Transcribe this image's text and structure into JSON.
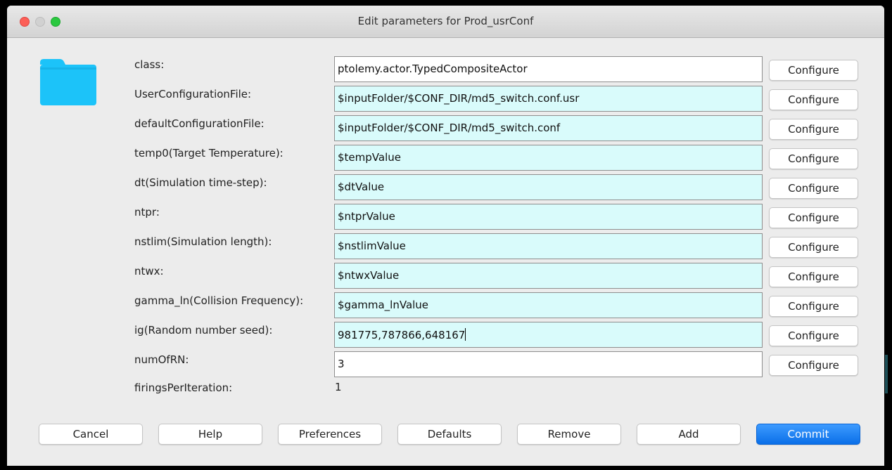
{
  "window": {
    "title": "Edit parameters for Prod_usrConf"
  },
  "icons": {
    "folder": "folder-icon",
    "folder_color": "#1cc3f9"
  },
  "params": [
    {
      "label": "class:",
      "value": "ptolemy.actor.TypedCompositeActor",
      "configure": "Configure"
    },
    {
      "label": "UserConfigurationFile:",
      "value": "$inputFolder/$CONF_DIR/md5_switch.conf.usr",
      "configure": "Configure"
    },
    {
      "label": "defaultConfigurationFile:",
      "value": "$inputFolder/$CONF_DIR/md5_switch.conf",
      "configure": "Configure"
    },
    {
      "label": "temp0(Target Temperature):",
      "value": "$tempValue",
      "configure": "Configure"
    },
    {
      "label": "dt(Simulation time-step):",
      "value": "$dtValue",
      "configure": "Configure"
    },
    {
      "label": "ntpr:",
      "value": "$ntprValue",
      "configure": "Configure"
    },
    {
      "label": "nstlim(Simulation length):",
      "value": "$nstlimValue",
      "configure": "Configure"
    },
    {
      "label": "ntwx:",
      "value": "$ntwxValue",
      "configure": "Configure"
    },
    {
      "label": "gamma_ln(Collision Frequency):",
      "value": "$gamma_lnValue",
      "configure": "Configure"
    },
    {
      "label": "ig(Random number seed):",
      "value": "981775,787866,648167",
      "configure": "Configure"
    },
    {
      "label": "numOfRN:",
      "value": "3",
      "configure": "Configure"
    },
    {
      "label": "firingsPerIteration:",
      "value": "1"
    }
  ],
  "buttons": {
    "cancel": "Cancel",
    "help": "Help",
    "preferences": "Preferences",
    "defaults": "Defaults",
    "remove": "Remove",
    "add": "Add",
    "commit": "Commit"
  },
  "colors": {
    "field_highlight": "#d9fbfb",
    "commit_blue": "#1a7ff5"
  }
}
